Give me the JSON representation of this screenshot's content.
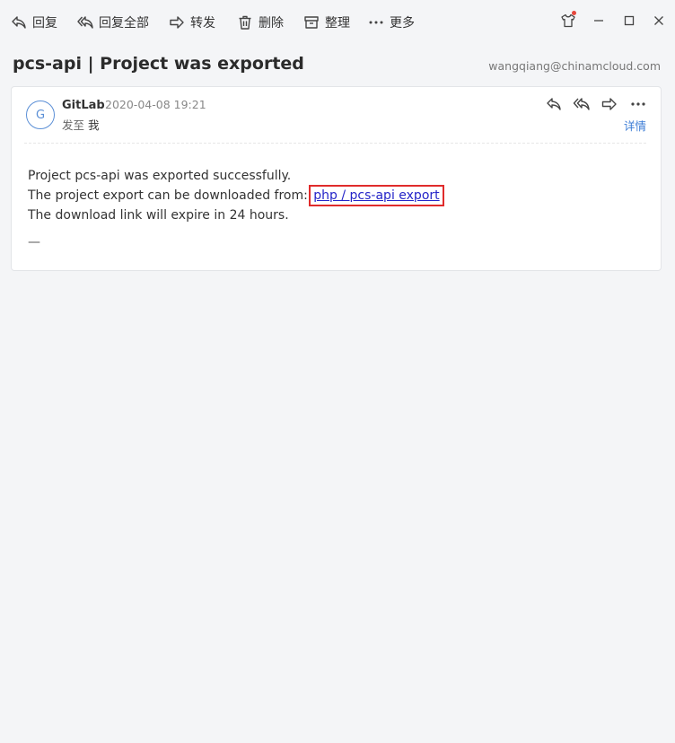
{
  "toolbar": {
    "reply": "回复",
    "reply_all": "回复全部",
    "forward": "转发",
    "delete": "删除",
    "organize": "整理",
    "more": "更多"
  },
  "email": {
    "subject": "pcs-api | Project was exported",
    "account": "wangqiang@chinamcloud.com",
    "avatar_letter": "G",
    "sender": "GitLab",
    "date": "2020-04-08 19:21",
    "to_label": "发至",
    "to_value": "我",
    "details": "详情",
    "body": {
      "line1": "Project pcs-api was exported successfully.",
      "line2_prefix": "The project export can be downloaded from:",
      "link_text": "php / pcs-api export",
      "line3": "The download link will expire in 24 hours.",
      "signature": "—"
    }
  },
  "colors": {
    "accent": "#3a7bd5",
    "link": "#2424c8",
    "highlight_box": "#e02b2b",
    "notification_dot": "#e5463b"
  }
}
